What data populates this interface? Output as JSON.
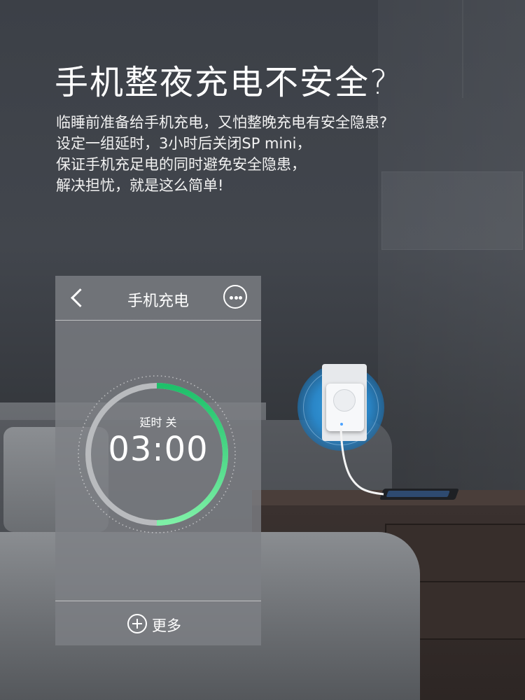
{
  "headline": "手机整夜充电不安全?",
  "description": [
    "临睡前准备给手机充电，又怕整晚充电有安全隐患?",
    "设定一组延时，3小时后关闭SP mini，",
    "保证手机充足电的同时避免安全隐患，",
    "解决担忧，就是这么简单!"
  ],
  "app": {
    "title": "手机充电",
    "back_icon": "chevron-left-icon",
    "menu_icon": "more-dots-icon",
    "timer": {
      "label": "延时 关",
      "time": "03:00",
      "progress": 0.5,
      "accent_color": "#3ddc7a",
      "track_color": "#b9bbbe"
    },
    "footer": {
      "icon": "plus-circle-icon",
      "label": "更多"
    }
  }
}
